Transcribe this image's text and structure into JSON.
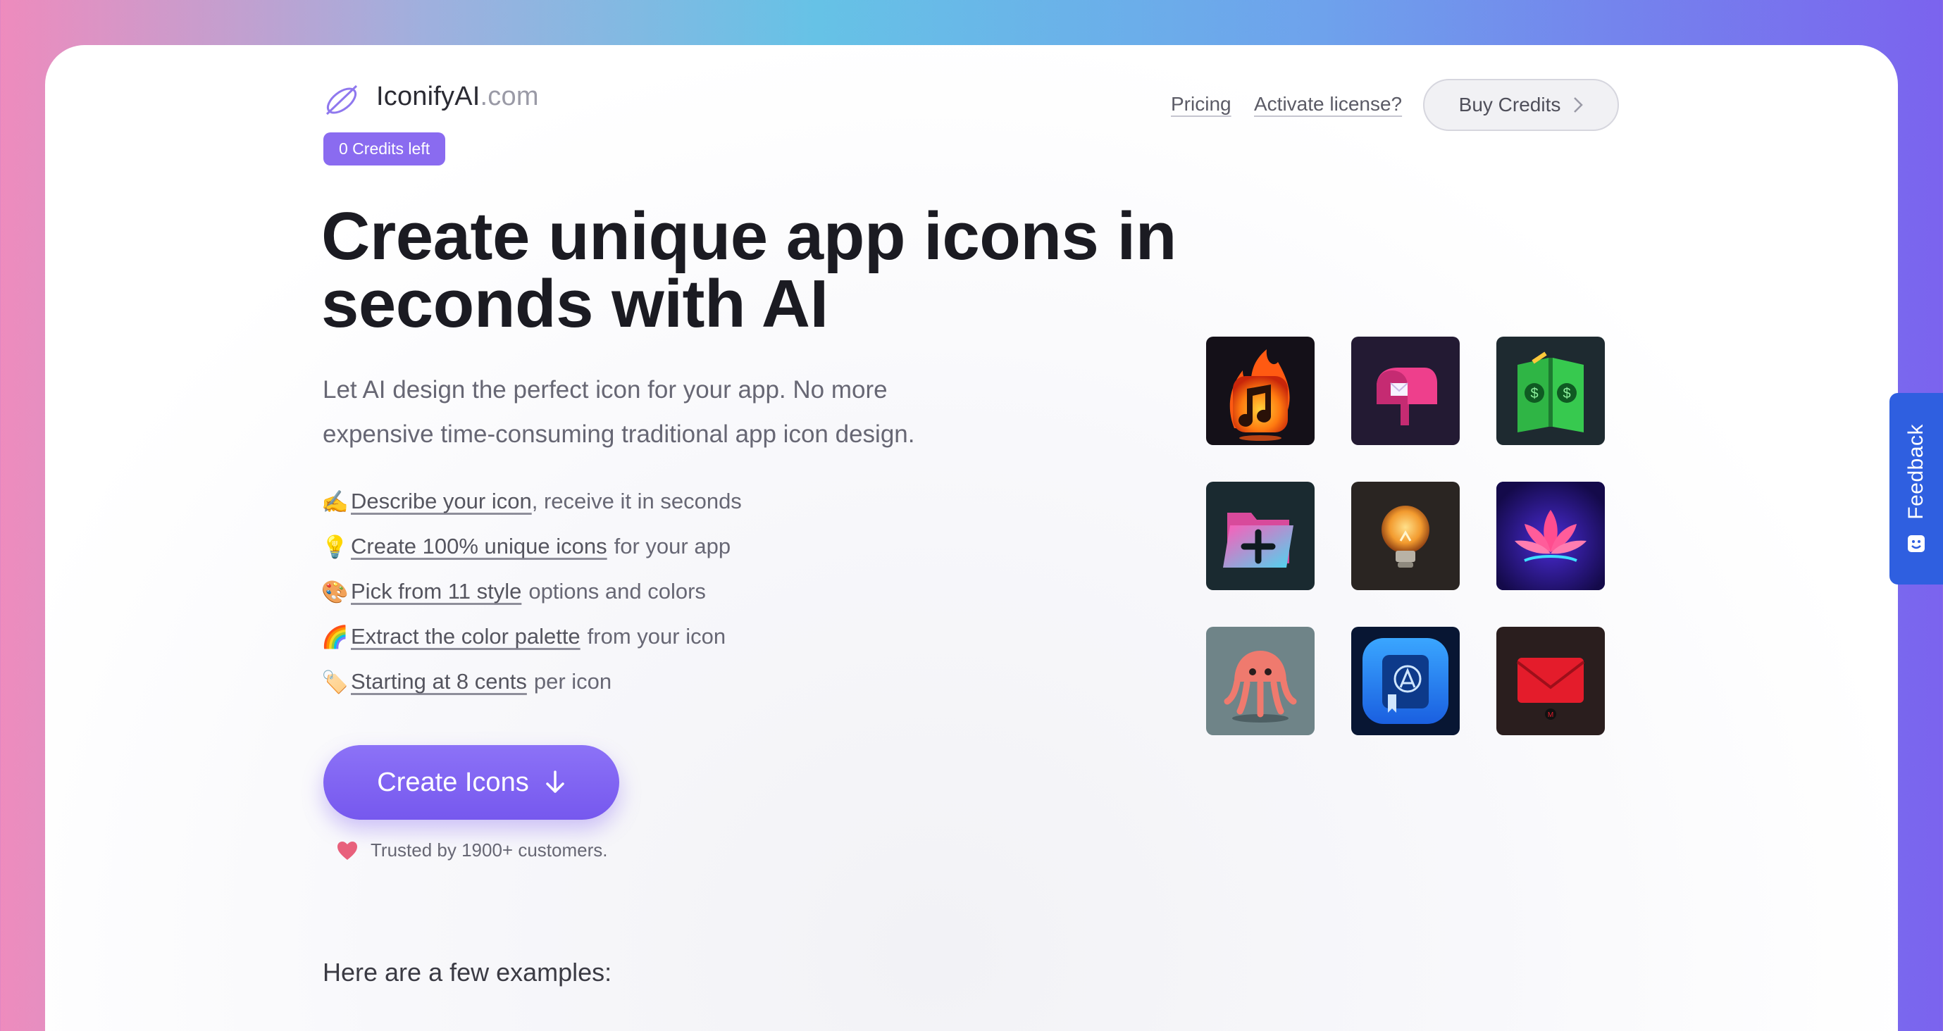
{
  "header": {
    "logo_name": "IconifyAI",
    "logo_domain": ".com",
    "credits_badge": "0 Credits left",
    "nav": {
      "pricing": "Pricing",
      "activate": "Activate license?"
    },
    "buy_button": "Buy Credits"
  },
  "hero": {
    "title": "Create unique app icons in seconds with AI",
    "subtitle": "Let AI design the perfect icon for your app. No more expensive time-consuming traditional app icon design.",
    "features": [
      {
        "emoji": "✍️",
        "link": "Describe your icon",
        "rest": ", receive it in seconds"
      },
      {
        "emoji": "💡",
        "link": "Create 100% unique icons",
        "rest": "for your app"
      },
      {
        "emoji": "🎨",
        "link": "Pick from 11 style",
        "rest": "options and colors"
      },
      {
        "emoji": "🌈",
        "link": "Extract the color palette",
        "rest": "from your icon"
      },
      {
        "emoji": "🏷️",
        "link": "Starting at 8 cents",
        "rest": "per icon"
      }
    ],
    "cta": "Create Icons",
    "trusted": "Trusted by 1900+ customers."
  },
  "examples_heading": "Here are a few examples:",
  "gallery": [
    {
      "icon": "fire-music-note-icon"
    },
    {
      "icon": "mailbox-icon"
    },
    {
      "icon": "money-book-icon"
    },
    {
      "icon": "folder-plus-icon"
    },
    {
      "icon": "lightbulb-icon"
    },
    {
      "icon": "neon-lotus-icon"
    },
    {
      "icon": "jellyfish-icon"
    },
    {
      "icon": "app-store-book-icon"
    },
    {
      "icon": "red-envelope-icon"
    }
  ],
  "feedback_tab": "Feedback",
  "colors": {
    "accent": "#8a6bf0",
    "feedback": "#2f5fe0"
  }
}
